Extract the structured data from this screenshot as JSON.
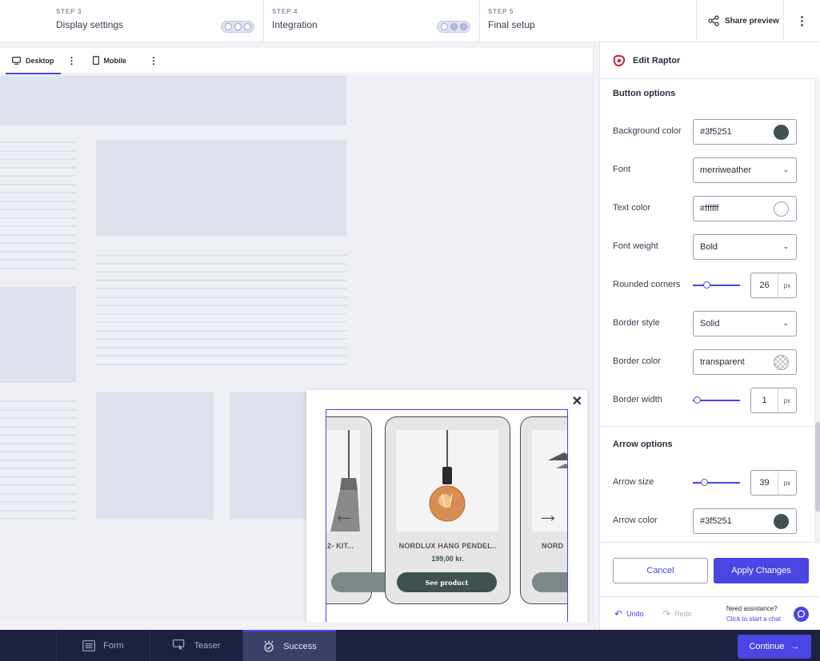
{
  "steps": [
    {
      "label": "STEP 3",
      "name": "Display settings"
    },
    {
      "label": "STEP 4",
      "name": "Integration"
    },
    {
      "label": "STEP 5",
      "name": "Final setup"
    }
  ],
  "header": {
    "share_label": "Share preview"
  },
  "device_tabs": {
    "desktop": "Desktop",
    "mobile": "Mobile"
  },
  "popup": {
    "products": [
      {
        "name": "2- KIT..."
      },
      {
        "name": "NORDLUX HANG PENDEL..",
        "price": "199,00 kr.",
        "cta": "See product"
      },
      {
        "name": "NORD"
      }
    ]
  },
  "panel": {
    "title": "Edit Raptor",
    "button_options": {
      "title": "Button options",
      "background_color_label": "Background color",
      "background_color": "#3f5251",
      "font_label": "Font",
      "font": "merriweather",
      "text_color_label": "Text color",
      "text_color": "#ffffff",
      "font_weight_label": "Font weight",
      "font_weight": "Bold",
      "rounded_corners_label": "Rounded corners",
      "rounded_corners": "26",
      "border_style_label": "Border style",
      "border_style": "Solid",
      "border_color_label": "Border color",
      "border_color": "transparent",
      "border_width_label": "Border width",
      "border_width": "1",
      "unit": "px"
    },
    "arrow_options": {
      "title": "Arrow options",
      "arrow_size_label": "Arrow size",
      "arrow_size": "39",
      "arrow_color_label": "Arrow color",
      "arrow_color": "#3f5251",
      "unit": "px"
    },
    "cancel_label": "Cancel",
    "apply_label": "Apply Changes",
    "undo_label": "Undo",
    "redo_label": "Redo",
    "assist_title": "Need assistance?",
    "assist_link": "Click to start a chat"
  },
  "bottom_tabs": [
    {
      "label": "Form"
    },
    {
      "label": "Teaser"
    },
    {
      "label": "Success"
    }
  ],
  "continue_label": "Continue",
  "colors": {
    "accent": "#4a45e3",
    "nav": "#1d2140",
    "button": "#3f5251"
  }
}
